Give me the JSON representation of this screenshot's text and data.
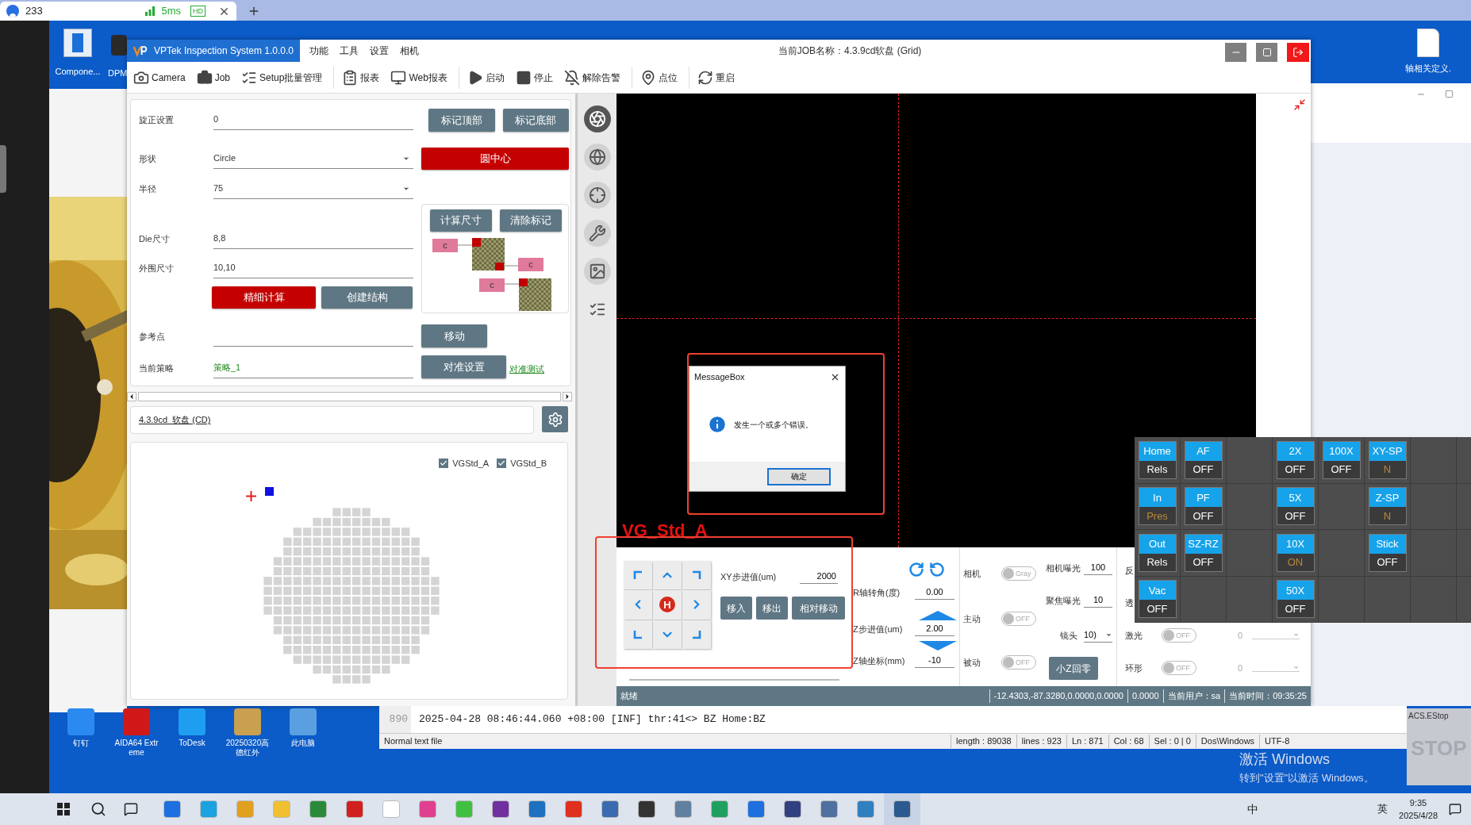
{
  "remote_tab": {
    "title": "233",
    "latency": "5ms",
    "quality": "HD"
  },
  "desktop_icons_top": [
    {
      "label": "Compone..."
    },
    {
      "label": "DPM"
    }
  ],
  "desktop_icon_right": {
    "label": "轴相关定义."
  },
  "window": {
    "title": "VPTek Inspection System 1.0.0.0",
    "menu": [
      "功能",
      "工具",
      "设置",
      "相机"
    ],
    "job_title": "当前JOB名称：4.3.9cd软盘 (Grid)"
  },
  "toolbar": [
    {
      "label": "Camera"
    },
    {
      "label": "Job"
    },
    {
      "label": "Setup批量管理"
    },
    {
      "label": "报表"
    },
    {
      "label": "Web报表"
    },
    {
      "label": "启动"
    },
    {
      "label": "停止"
    },
    {
      "label": "解除告警"
    },
    {
      "label": "点位"
    },
    {
      "label": "重启"
    }
  ],
  "form": {
    "rows": [
      {
        "kind": "input",
        "label": "旋正设置",
        "value": "0"
      },
      {
        "kind": "dropdown",
        "label": "形状",
        "value": "Circle"
      },
      {
        "kind": "dropdown",
        "label": "半径",
        "value": "75"
      },
      {
        "kind": "input",
        "label": "Die尺寸",
        "value": "8,8"
      },
      {
        "kind": "input",
        "label": "外围尺寸",
        "value": "10,10"
      },
      {
        "kind": "buttons",
        "buttons": [
          {
            "label": "精细计算",
            "primary": true
          },
          {
            "label": "创建结构",
            "primary": false
          }
        ]
      },
      {
        "kind": "input",
        "label": "参考点"
      },
      {
        "kind": "strategy",
        "label": "当前策略",
        "value": "策略_1"
      }
    ]
  },
  "side": {
    "mark_buttons": [
      {
        "label": "标记顶部",
        "primary": false
      },
      {
        "label": "标记底部",
        "primary": false
      }
    ],
    "center_button": {
      "label": "圆中心",
      "primary": true
    },
    "size_buttons": [
      {
        "label": "计算尺寸",
        "primary": false
      },
      {
        "label": "清除标记",
        "primary": false
      }
    ],
    "die_tags": [
      "c",
      "c",
      "c"
    ],
    "move_button": {
      "label": "移动",
      "primary": false
    },
    "align_button": {
      "label": "对准设置",
      "primary": false
    },
    "align_link": "对准测试"
  },
  "job_path": "4.3.9cd_软盘 (CD)",
  "wafer": {
    "layers": [
      {
        "label": "VGStd_A",
        "checked": true
      },
      {
        "label": "VGStd_B",
        "checked": true
      }
    ]
  },
  "message_box": {
    "title": "MessageBox",
    "message": "发生一个或多个错误。",
    "ok": "确定"
  },
  "viewer_label": "VG_Std_A",
  "motion": {
    "jog_center": "H",
    "xy_step": {
      "label": "XY步进值(um)",
      "value": "2000"
    },
    "buttons": [
      "移入",
      "移出",
      "相对移动"
    ],
    "axes": [
      {
        "label": "R轴转角(度)",
        "value": "0.00"
      },
      {
        "label": "Z步进值(um)",
        "value": "2.00"
      },
      {
        "label": "Z轴坐标(mm)",
        "value": "-10"
      }
    ],
    "modes": [
      {
        "label": "相机",
        "toggle": "Gray",
        "on": false
      },
      {
        "label": "主动",
        "toggle": "OFF",
        "on": false
      },
      {
        "label": "被动",
        "toggle": "OFF",
        "on": false
      }
    ],
    "camera": [
      {
        "label": "相机曝光",
        "value": "100"
      },
      {
        "label": "聚焦曝光",
        "value": "10"
      }
    ],
    "lens": {
      "label": "镜头",
      "value": "10)"
    },
    "z_home": "小Z回零",
    "lights": [
      {
        "kind": "label",
        "label": "反"
      },
      {
        "kind": "label",
        "label": "透"
      },
      {
        "kind": "toggle",
        "label": "激光",
        "toggle": "OFF",
        "on": false,
        "value": "0"
      },
      {
        "kind": "toggle",
        "label": "环形",
        "toggle": "OFF",
        "on": false,
        "value": "0"
      }
    ]
  },
  "status_bar": [
    "就绪",
    "-12.4303,-87.3280,0.0000,0.0000",
    "0.0000",
    "当前用户：sa",
    "当前时间：09:35:25"
  ],
  "io_panel": {
    "rows": [
      [
        {
          "kind": "toggle",
          "label": "Home",
          "value": "Rels",
          "highlighted": false
        },
        {
          "kind": "toggle",
          "label": "AF",
          "value": "OFF",
          "highlighted": false
        },
        {
          "kind": "empty"
        },
        {
          "kind": "toggle",
          "label": "2X",
          "value": "OFF",
          "highlighted": false
        },
        {
          "kind": "toggle",
          "label": "100X",
          "value": "OFF",
          "highlighted": false
        },
        {
          "kind": "toggle",
          "label": "XY-SP",
          "value": "N",
          "highlighted": true
        },
        {
          "kind": "empty"
        },
        {
          "kind": "empty"
        }
      ],
      [
        {
          "kind": "toggle",
          "label": "In",
          "value": "Pres",
          "highlighted": true
        },
        {
          "kind": "toggle",
          "label": "PF",
          "value": "OFF",
          "highlighted": false
        },
        {
          "kind": "empty"
        },
        {
          "kind": "toggle",
          "label": "5X",
          "value": "OFF",
          "highlighted": false
        },
        {
          "kind": "empty"
        },
        {
          "kind": "toggle",
          "label": "Z-SP",
          "value": "N",
          "highlighted": true
        },
        {
          "kind": "empty"
        },
        {
          "kind": "empty"
        }
      ],
      [
        {
          "kind": "toggle",
          "label": "Out",
          "value": "Rels",
          "highlighted": false
        },
        {
          "kind": "toggle",
          "label": "SZ-RZ",
          "value": "OFF",
          "highlighted": false
        },
        {
          "kind": "empty"
        },
        {
          "kind": "toggle",
          "label": "10X",
          "value": "ON",
          "highlighted": true
        },
        {
          "kind": "empty"
        },
        {
          "kind": "toggle",
          "label": "Stick",
          "value": "OFF",
          "highlighted": false
        },
        {
          "kind": "empty"
        },
        {
          "kind": "empty"
        }
      ],
      [
        {
          "kind": "toggle",
          "label": "Vac",
          "value": "OFF",
          "highlighted": false
        },
        {
          "kind": "empty"
        },
        {
          "kind": "empty"
        },
        {
          "kind": "toggle",
          "label": "50X",
          "value": "OFF",
          "highlighted": false
        },
        {
          "kind": "empty"
        },
        {
          "kind": "empty"
        },
        {
          "kind": "empty"
        },
        {
          "kind": "empty"
        }
      ]
    ]
  },
  "editor": {
    "line_number": "890",
    "line": "2025-04-28 08:46:44.060 +08:00 [INF] thr:41<> BZ Home:BZ",
    "status": [
      "Normal text file",
      "length : 89038",
      "lines : 923",
      "Ln : 871",
      "Col : 68",
      "Sel : 0 | 0",
      "Dos\\Windows",
      "UTF-8"
    ]
  },
  "desktop_icons_bottom": [
    {
      "label": "钉钉"
    },
    {
      "label": "AIDA64 Extreme"
    },
    {
      "label": "ToDesk"
    },
    {
      "label": "20250320高德红外"
    },
    {
      "label": "此电脑"
    }
  ],
  "activation": {
    "title": "激活 Windows",
    "hint": "转到\"设置\"以激活 Windows。"
  },
  "estop": {
    "title": "ACS.EStop",
    "label": "STOP"
  },
  "taskbar": {
    "ime": "中",
    "lang": "英",
    "time": "9:35",
    "date": "2025/4/28"
  }
}
